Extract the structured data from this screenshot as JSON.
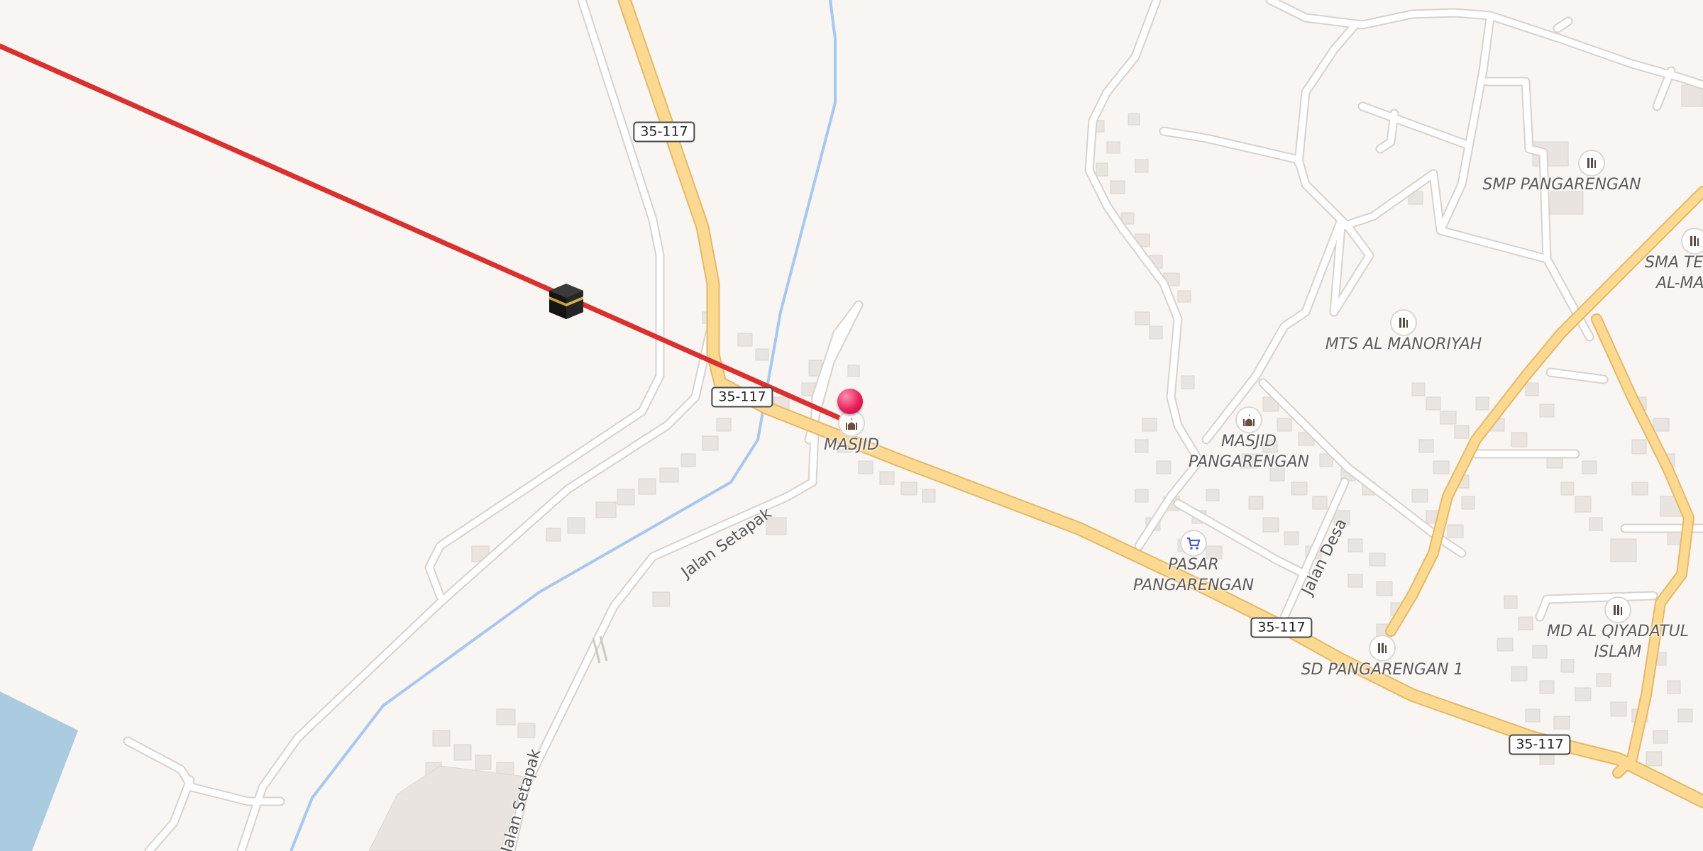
{
  "map": {
    "colors": {
      "land": "#f8f5f2",
      "road_minor": "#ffffff",
      "road_minor_casing": "#d9d2cc",
      "road_major": "#fcd990",
      "road_major_casing": "#e6b868",
      "river": "#a8c8f0",
      "water": "#aacbe0",
      "building": "#e9e4df",
      "qibla_line": "#d93030",
      "pin": "#e8215b"
    },
    "route_shields": [
      "35-117",
      "35-117",
      "35-117",
      "35-117"
    ],
    "street_labels": [
      "Jalan Setapak",
      "Jalan Desa",
      "Jalan Setapak"
    ],
    "pois": [
      {
        "lines": [
          "MASJID"
        ],
        "icon": "mosque-icon"
      },
      {
        "lines": [
          "MASJID",
          "PANGARENGAN"
        ],
        "icon": "mosque-icon"
      },
      {
        "lines": [
          "PASAR",
          "PANGARENGAN"
        ],
        "icon": "shopping-cart-icon"
      },
      {
        "lines": [
          "SMP PANGARENGAN"
        ],
        "icon": "school-icon"
      },
      {
        "lines": [
          "MTS AL MANORIYAH"
        ],
        "icon": "school-icon"
      },
      {
        "lines": [
          "SD PANGARENGAN 1"
        ],
        "icon": "school-icon"
      },
      {
        "lines": [
          "MD AL QIYADATUL",
          "ISLAM"
        ],
        "icon": "school-icon"
      },
      {
        "lines": [
          "SMA TE",
          "AL-MA"
        ],
        "icon": "school-icon"
      }
    ],
    "markers": [
      {
        "name": "location-pin-icon",
        "color": "#e8215b"
      },
      {
        "name": "kaaba-icon",
        "color": "#1f1f1f"
      }
    ]
  }
}
